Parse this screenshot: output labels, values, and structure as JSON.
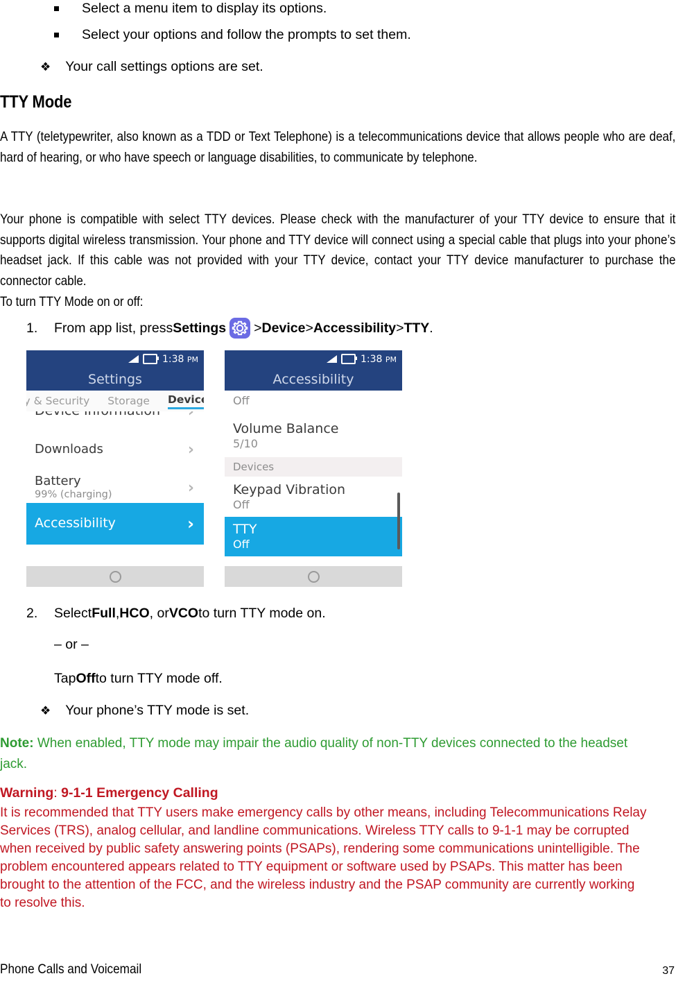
{
  "top_bullets": [
    {
      "marker": "square",
      "text": "Select a menu item to display its options."
    },
    {
      "marker": "square",
      "text": "Select your options and follow the prompts to set them."
    },
    {
      "marker": "diamond",
      "text": "Your call settings options are set."
    }
  ],
  "heading": "TTY Mode",
  "paragraphs": {
    "p1": "A TTY (teletypewriter, also known as a TDD or Text Telephone) is a telecommunications device that allows people who are deaf, hard of hearing, or who have speech or language disabilities, to communicate by telephone.",
    "p2": "Your phone is compatible with select TTY devices. Please check with the manufacturer of your TTY device to ensure that it supports digital wireless transmission. Your phone and TTY device will connect using a special cable that plugs into your phone’s headset jack. If this cable was not provided with your TTY device, contact your TTY device manufacturer to purchase the connector cable."
  },
  "lead_in": "To turn TTY Mode on or off:",
  "step1": {
    "number": "1.",
    "prefix": "From app list, press ",
    "settings_label": "Settings",
    "icon": "gear-icon",
    "sep1": " > ",
    "device_label": "Device",
    "sep2": " > ",
    "accessibility_label": "Accessibility",
    "sep3": " > ",
    "tty_label": "TTY",
    "suffix": "."
  },
  "step2": {
    "number": "2.",
    "prefix": "Select ",
    "opt_full": "Full",
    "comma1": ", ",
    "opt_hco": "HCO",
    "comma2": ", or ",
    "opt_vco": "VCO",
    "suffix": " to turn TTY mode on."
  },
  "or_divider": "– or –",
  "step_off": {
    "prefix": "Tap ",
    "bold": "Off",
    "suffix": " to turn TTY mode off."
  },
  "result": {
    "marker": "diamond",
    "text": "Your phone’s TTY mode is set."
  },
  "note": {
    "label": "Note:",
    "text": " When enabled, TTY mode may impair the audio quality of non-TTY devices connected to the headset jack.",
    "color": "#2E9B32"
  },
  "warning": {
    "label": "Warning",
    "colon": ": ",
    "title": "9-1-1 Emergency Calling",
    "body": "It is recommended that TTY users make emergency calls by other means, including Telecommunications Relay Services (TRS), analog cellular, and landline communications. Wireless TTY calls to 9-1-1 may be corrupted when received by public safety answering points (PSAPs), rendering some communications unintelligible. The problem encountered appears related to TTY equipment or software used by PSAPs. This matter has been brought to the attention of the FCC, and the wireless industry and the PSAP community are currently working to resolve this.",
    "color": "#C01722"
  },
  "footer": {
    "left": "Phone Calls and Voicemail",
    "page_number": "37"
  },
  "phone_left": {
    "statusbar": {
      "signal_icon": "signal-bars-icon",
      "battery_icon": "battery-icon",
      "time": "1:38",
      "ampm": "PM"
    },
    "title": "Settings",
    "tabs": [
      {
        "label": "cy & Security",
        "active": false
      },
      {
        "label": "Storage",
        "active": false
      },
      {
        "label": "Device",
        "active": true
      }
    ],
    "rows": [
      {
        "title": "Device Information",
        "sub": "",
        "chevron": "›",
        "selected": false
      },
      {
        "title": "Downloads",
        "sub": "",
        "chevron": "›",
        "selected": false
      },
      {
        "title": "Battery",
        "sub": "99% (charging)",
        "chevron": "›",
        "selected": false
      },
      {
        "title": "Accessibility",
        "sub": "",
        "chevron": "›",
        "selected": true
      }
    ],
    "nav_icon": "home-circle-icon",
    "colors": {
      "statusbar": "#24437F",
      "selected_row": "#17A8E3",
      "tab_underline": "#2BA8E0"
    }
  },
  "phone_right": {
    "statusbar": {
      "signal_icon": "signal-bars-icon",
      "battery_icon": "battery-icon",
      "time": "1:38",
      "ampm": "PM"
    },
    "title": "Accessibility",
    "rows": [
      {
        "type": "item",
        "title": "",
        "sub": "Off",
        "selected": false
      },
      {
        "type": "item",
        "title": "Volume Balance",
        "sub": "5/10",
        "selected": false
      },
      {
        "type": "header",
        "title": "Devices"
      },
      {
        "type": "item",
        "title": "Keypad Vibration",
        "sub": "Off",
        "selected": false
      },
      {
        "type": "item",
        "title": "TTY",
        "sub": "Off",
        "selected": true
      }
    ],
    "scrollbar": true,
    "nav_icon": "home-circle-icon",
    "colors": {
      "statusbar": "#24437F",
      "selected_row": "#17A8E3",
      "section_header": "#F3EFF0"
    }
  }
}
